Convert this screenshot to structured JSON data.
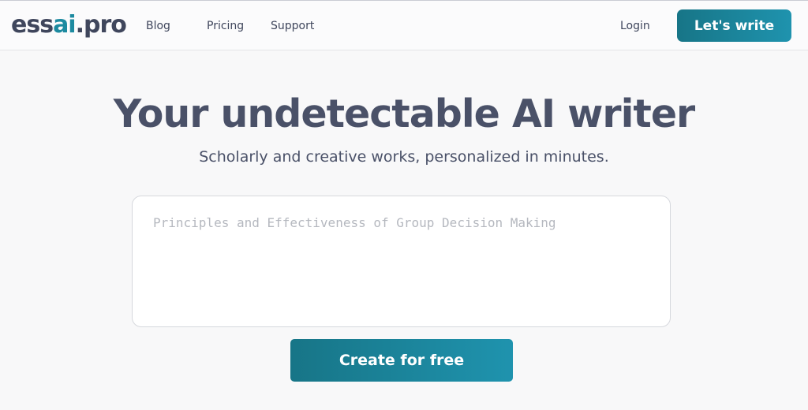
{
  "header": {
    "logo": {
      "part1": "ess",
      "accent": "ai",
      "part2": ".pro"
    },
    "nav": {
      "blog": "Blog",
      "pricing": "Pricing",
      "support": "Support"
    },
    "login": "Login",
    "cta": "Let's write"
  },
  "hero": {
    "title": "Your undetectable AI writer",
    "subtitle": "Scholarly and creative works, personalized in minutes."
  },
  "form": {
    "topic_placeholder": "Principles and Effectiveness of Group Decision Making",
    "topic_value": "",
    "submit": "Create for free"
  },
  "colors": {
    "brand": "#1c8aa0",
    "button_gradient_start": "#177587",
    "button_gradient_end": "#1f93ae",
    "text": "#4a5168"
  }
}
